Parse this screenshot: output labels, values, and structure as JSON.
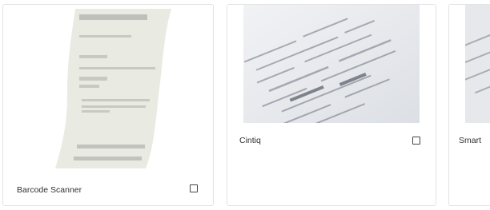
{
  "cards": [
    {
      "label": "Barcode Scanner",
      "selected": false,
      "image_icon": "receipt-illustration-icon"
    },
    {
      "label": "Cintiq",
      "selected": false,
      "image_icon": "receipt-photo"
    },
    {
      "label": "Smart",
      "selected": false,
      "image_icon": "receipt-photo"
    }
  ],
  "colors": {
    "card_border": "#e3e3e3",
    "receipt_fill": "#e9ebe3",
    "receipt_lines": "#bfc0bb",
    "label_text": "#2f2f2f"
  }
}
